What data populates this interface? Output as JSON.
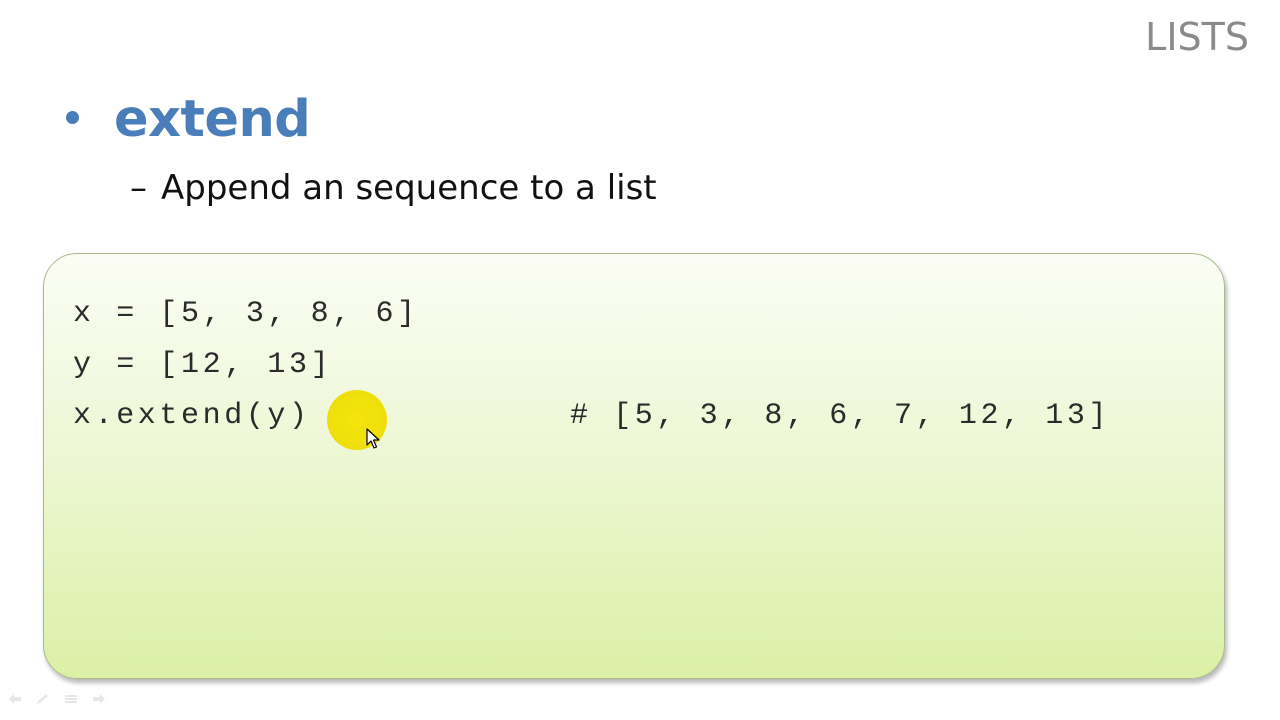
{
  "slide": {
    "title": "LISTS",
    "bullet": "extend",
    "sub_bullet_marker": "–",
    "sub_bullet": "Append an sequence to a list"
  },
  "code": {
    "lines": [
      "x = [5, 3, 8, 6]",
      "y = [12, 13]",
      "x.extend(y)"
    ],
    "comment": "# [5, 3, 8, 6, 7, 12, 13]"
  },
  "controls": {
    "icons": [
      "arrow-left-icon",
      "pen-icon",
      "menu-icon",
      "arrow-right-icon"
    ]
  },
  "colors": {
    "accent": "#4a7ebb",
    "title_gray": "#8a8a8a",
    "highlight": "#f2e200"
  }
}
